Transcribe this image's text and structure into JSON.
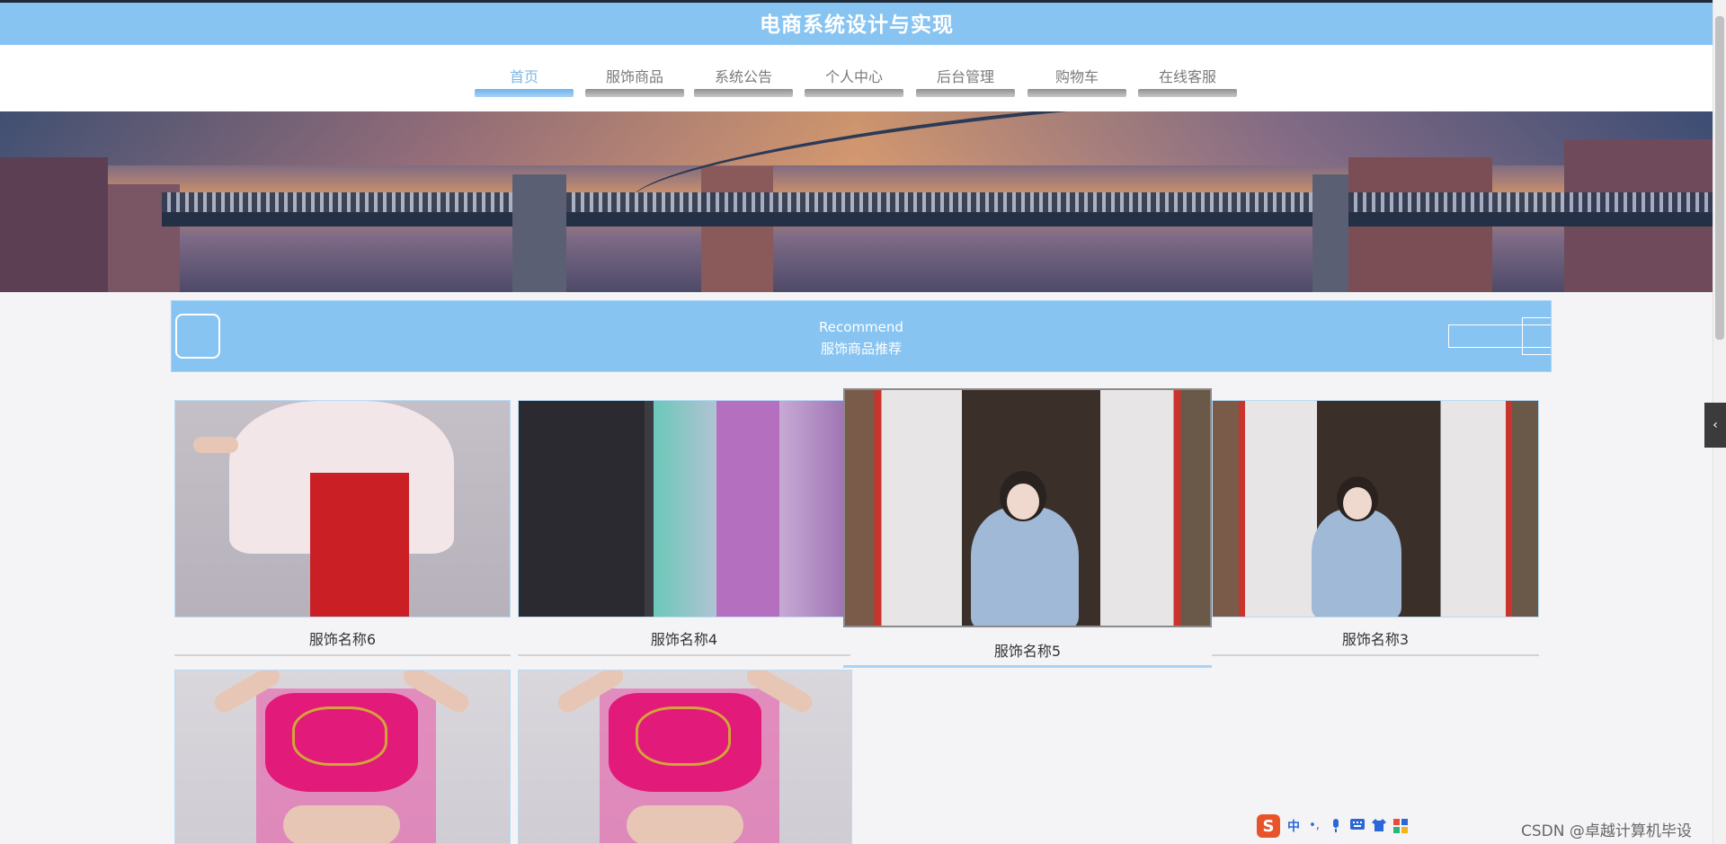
{
  "header": {
    "title": "电商系统设计与实现"
  },
  "nav": {
    "items": [
      {
        "label": "首页",
        "active": true
      },
      {
        "label": "服饰商品"
      },
      {
        "label": "系统公告"
      },
      {
        "label": "个人中心"
      },
      {
        "label": "后台管理"
      },
      {
        "label": "购物车"
      },
      {
        "label": "在线客服"
      }
    ]
  },
  "recommend": {
    "title": "Recommend",
    "subtitle": "服饰商品推荐"
  },
  "products": [
    {
      "name": "服饰名称6"
    },
    {
      "name": "服饰名称4"
    },
    {
      "name": "服饰名称5"
    },
    {
      "name": "服饰名称3"
    },
    {
      "name": ""
    },
    {
      "name": ""
    }
  ],
  "side_tab": {
    "icon": "chevron-left-icon",
    "glyph": "‹"
  },
  "ime": {
    "logo": "S",
    "mode": "中",
    "icons": [
      "punctuation-icon",
      "microphone-icon",
      "keyboard-icon",
      "skin-icon",
      "toolbox-icon"
    ]
  },
  "watermark": "CSDN @卓越计算机毕设",
  "colors": {
    "accent": "#88c4f1",
    "nav_active": "#7fb8e6",
    "nav_bar": "#9e9e9e"
  }
}
